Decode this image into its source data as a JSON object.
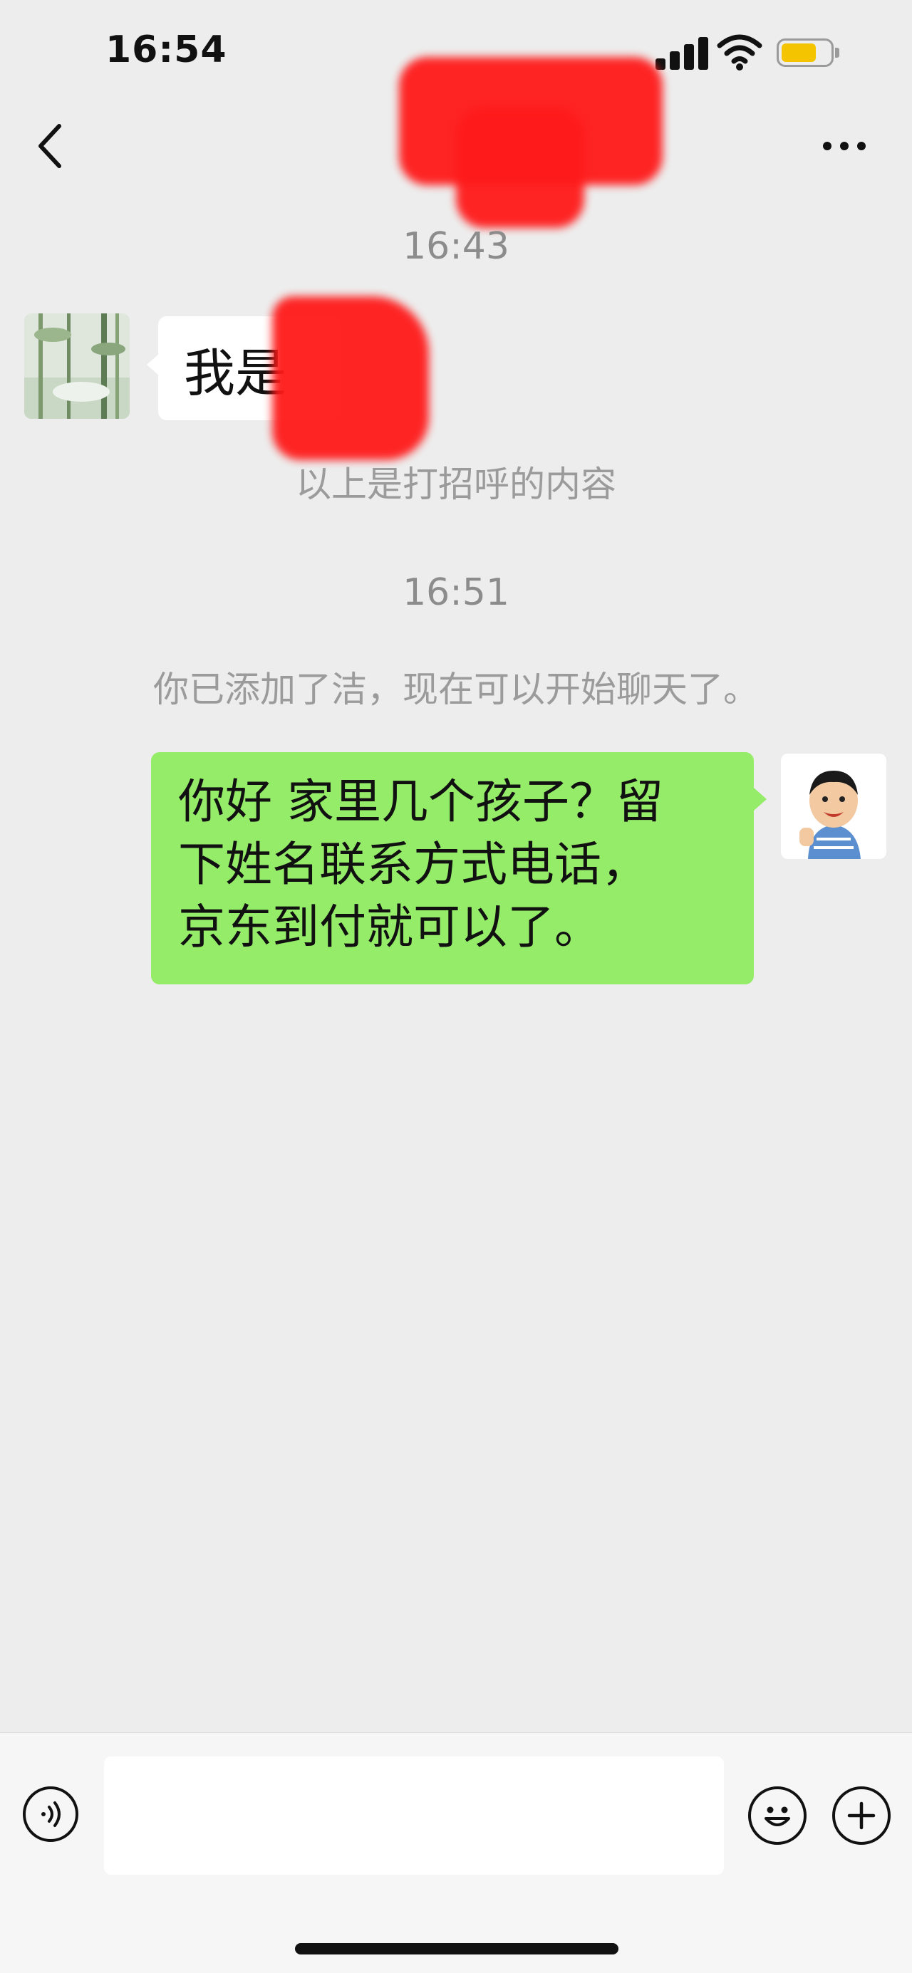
{
  "status_bar": {
    "time": "16:54",
    "battery_color": "#f5c400"
  },
  "nav": {
    "back_icon": "chevron-left-icon",
    "more_icon": "more-dots-icon"
  },
  "chat": {
    "timestamp_1": "16:43",
    "incoming_message": "我是",
    "greeting_note": "以上是打招呼的内容",
    "timestamp_2": "16:51",
    "added_notice": "你已添加了洁，现在可以开始聊天了。",
    "outgoing_message_lines": [
      "你好 家里几个孩子？留",
      "下姓名联系方式电话，",
      "京东到付就可以了。"
    ]
  },
  "input_bar": {
    "voice_icon": "voice-icon",
    "emoji_icon": "emoji-icon",
    "add_icon": "plus-icon",
    "message_value": ""
  },
  "colors": {
    "outgoing_bubble": "#95ec69",
    "incoming_bubble": "#ffffff",
    "background": "#ededed"
  }
}
